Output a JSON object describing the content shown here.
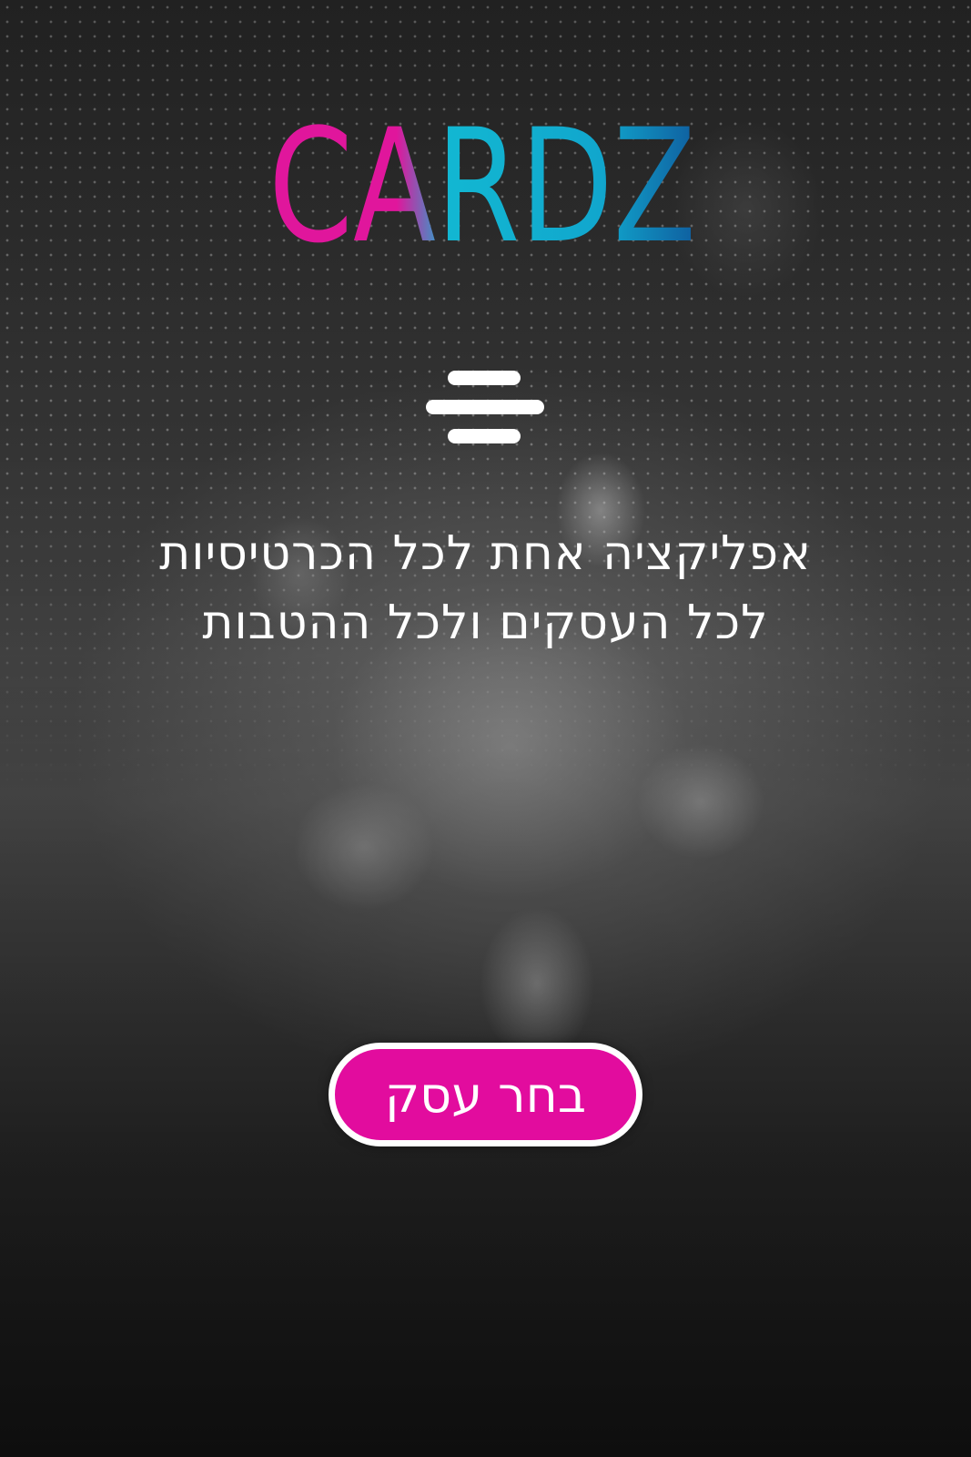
{
  "brand": {
    "logo_text": "CARDZ",
    "colors": {
      "pink": "#e0169c",
      "cyan": "#11b3cf",
      "blue": "#0f6ba6"
    }
  },
  "menu": {
    "icon": "hamburger-icon"
  },
  "tagline": {
    "line1": "אפליקציה אחת לכל הכרטיסיות",
    "line2": "לכל העסקים ולכל ההטבות"
  },
  "cta": {
    "label": "בחר עסק",
    "color": "#e20c9e"
  },
  "background": {
    "description_icon": "group-photo-background"
  }
}
